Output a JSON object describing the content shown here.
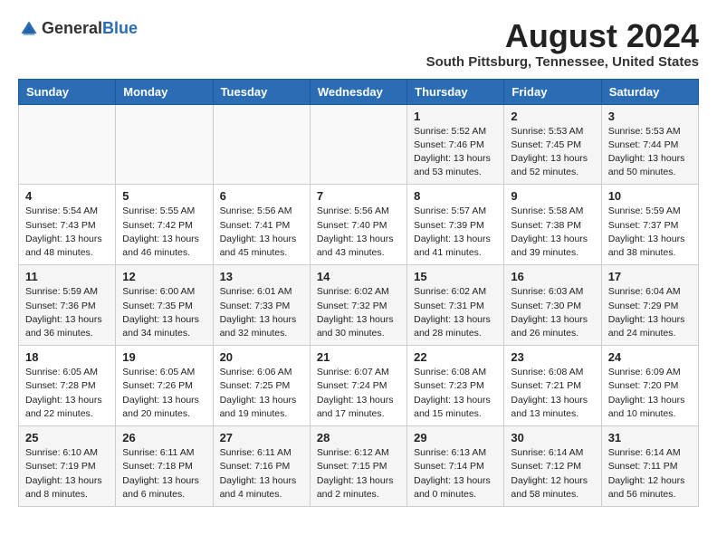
{
  "header": {
    "logo_general": "General",
    "logo_blue": "Blue",
    "month_title": "August 2024",
    "location": "South Pittsburg, Tennessee, United States"
  },
  "days_of_week": [
    "Sunday",
    "Monday",
    "Tuesday",
    "Wednesday",
    "Thursday",
    "Friday",
    "Saturday"
  ],
  "weeks": [
    [
      {
        "day": "",
        "info": ""
      },
      {
        "day": "",
        "info": ""
      },
      {
        "day": "",
        "info": ""
      },
      {
        "day": "",
        "info": ""
      },
      {
        "day": "1",
        "info": "Sunrise: 5:52 AM\nSunset: 7:46 PM\nDaylight: 13 hours\nand 53 minutes."
      },
      {
        "day": "2",
        "info": "Sunrise: 5:53 AM\nSunset: 7:45 PM\nDaylight: 13 hours\nand 52 minutes."
      },
      {
        "day": "3",
        "info": "Sunrise: 5:53 AM\nSunset: 7:44 PM\nDaylight: 13 hours\nand 50 minutes."
      }
    ],
    [
      {
        "day": "4",
        "info": "Sunrise: 5:54 AM\nSunset: 7:43 PM\nDaylight: 13 hours\nand 48 minutes."
      },
      {
        "day": "5",
        "info": "Sunrise: 5:55 AM\nSunset: 7:42 PM\nDaylight: 13 hours\nand 46 minutes."
      },
      {
        "day": "6",
        "info": "Sunrise: 5:56 AM\nSunset: 7:41 PM\nDaylight: 13 hours\nand 45 minutes."
      },
      {
        "day": "7",
        "info": "Sunrise: 5:56 AM\nSunset: 7:40 PM\nDaylight: 13 hours\nand 43 minutes."
      },
      {
        "day": "8",
        "info": "Sunrise: 5:57 AM\nSunset: 7:39 PM\nDaylight: 13 hours\nand 41 minutes."
      },
      {
        "day": "9",
        "info": "Sunrise: 5:58 AM\nSunset: 7:38 PM\nDaylight: 13 hours\nand 39 minutes."
      },
      {
        "day": "10",
        "info": "Sunrise: 5:59 AM\nSunset: 7:37 PM\nDaylight: 13 hours\nand 38 minutes."
      }
    ],
    [
      {
        "day": "11",
        "info": "Sunrise: 5:59 AM\nSunset: 7:36 PM\nDaylight: 13 hours\nand 36 minutes."
      },
      {
        "day": "12",
        "info": "Sunrise: 6:00 AM\nSunset: 7:35 PM\nDaylight: 13 hours\nand 34 minutes."
      },
      {
        "day": "13",
        "info": "Sunrise: 6:01 AM\nSunset: 7:33 PM\nDaylight: 13 hours\nand 32 minutes."
      },
      {
        "day": "14",
        "info": "Sunrise: 6:02 AM\nSunset: 7:32 PM\nDaylight: 13 hours\nand 30 minutes."
      },
      {
        "day": "15",
        "info": "Sunrise: 6:02 AM\nSunset: 7:31 PM\nDaylight: 13 hours\nand 28 minutes."
      },
      {
        "day": "16",
        "info": "Sunrise: 6:03 AM\nSunset: 7:30 PM\nDaylight: 13 hours\nand 26 minutes."
      },
      {
        "day": "17",
        "info": "Sunrise: 6:04 AM\nSunset: 7:29 PM\nDaylight: 13 hours\nand 24 minutes."
      }
    ],
    [
      {
        "day": "18",
        "info": "Sunrise: 6:05 AM\nSunset: 7:28 PM\nDaylight: 13 hours\nand 22 minutes."
      },
      {
        "day": "19",
        "info": "Sunrise: 6:05 AM\nSunset: 7:26 PM\nDaylight: 13 hours\nand 20 minutes."
      },
      {
        "day": "20",
        "info": "Sunrise: 6:06 AM\nSunset: 7:25 PM\nDaylight: 13 hours\nand 19 minutes."
      },
      {
        "day": "21",
        "info": "Sunrise: 6:07 AM\nSunset: 7:24 PM\nDaylight: 13 hours\nand 17 minutes."
      },
      {
        "day": "22",
        "info": "Sunrise: 6:08 AM\nSunset: 7:23 PM\nDaylight: 13 hours\nand 15 minutes."
      },
      {
        "day": "23",
        "info": "Sunrise: 6:08 AM\nSunset: 7:21 PM\nDaylight: 13 hours\nand 13 minutes."
      },
      {
        "day": "24",
        "info": "Sunrise: 6:09 AM\nSunset: 7:20 PM\nDaylight: 13 hours\nand 10 minutes."
      }
    ],
    [
      {
        "day": "25",
        "info": "Sunrise: 6:10 AM\nSunset: 7:19 PM\nDaylight: 13 hours\nand 8 minutes."
      },
      {
        "day": "26",
        "info": "Sunrise: 6:11 AM\nSunset: 7:18 PM\nDaylight: 13 hours\nand 6 minutes."
      },
      {
        "day": "27",
        "info": "Sunrise: 6:11 AM\nSunset: 7:16 PM\nDaylight: 13 hours\nand 4 minutes."
      },
      {
        "day": "28",
        "info": "Sunrise: 6:12 AM\nSunset: 7:15 PM\nDaylight: 13 hours\nand 2 minutes."
      },
      {
        "day": "29",
        "info": "Sunrise: 6:13 AM\nSunset: 7:14 PM\nDaylight: 13 hours\nand 0 minutes."
      },
      {
        "day": "30",
        "info": "Sunrise: 6:14 AM\nSunset: 7:12 PM\nDaylight: 12 hours\nand 58 minutes."
      },
      {
        "day": "31",
        "info": "Sunrise: 6:14 AM\nSunset: 7:11 PM\nDaylight: 12 hours\nand 56 minutes."
      }
    ]
  ]
}
